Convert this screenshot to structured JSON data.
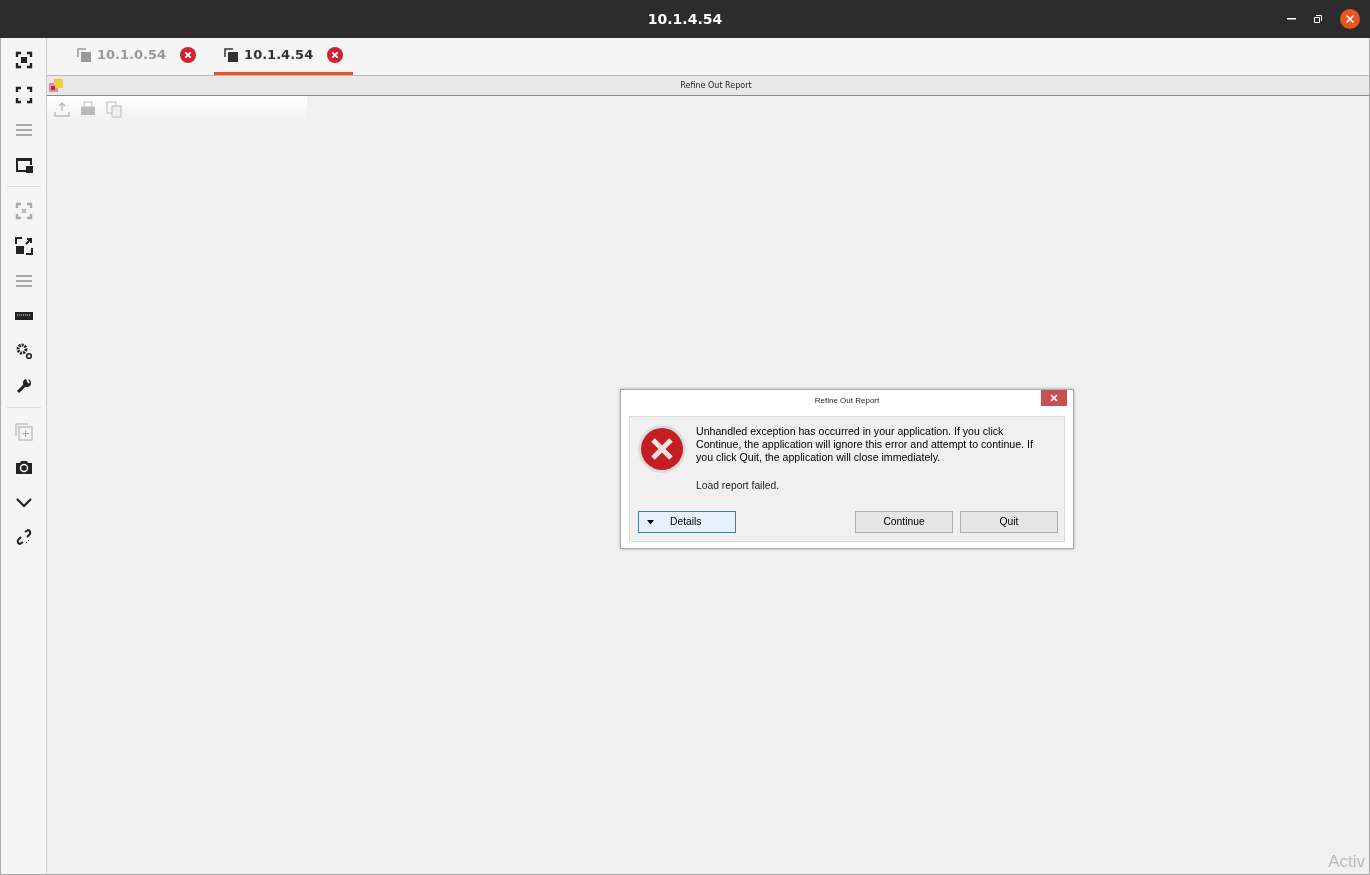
{
  "window": {
    "title": "10.1.4.54"
  },
  "sidebar": {
    "groups": [
      {
        "items": [
          {
            "disabled": false
          },
          {
            "disabled": false
          },
          {
            "disabled": true
          },
          {
            "disabled": false
          }
        ]
      },
      {
        "items": [
          {
            "disabled": true
          },
          {
            "disabled": false
          },
          {
            "disabled": true
          },
          {
            "disabled": false
          },
          {
            "disabled": false
          },
          {
            "disabled": false
          }
        ]
      },
      {
        "items": [
          {
            "disabled": true
          },
          {
            "disabled": false
          },
          {
            "disabled": false
          },
          {
            "disabled": false
          }
        ]
      }
    ]
  },
  "tabs": [
    {
      "label": "10.1.0.54",
      "selected": false
    },
    {
      "label": "10.1.4.54",
      "selected": true
    }
  ],
  "report_window": {
    "title": "Refine Out Report",
    "toolbar": [
      {
        "disabled": true
      },
      {
        "disabled": true
      },
      {
        "disabled": true
      }
    ]
  },
  "dialog": {
    "title": "Refine Out Report",
    "message": "Unhandled exception has occurred in your application. If you click Continue, the application will ignore this error and attempt to continue. If you click Quit, the application will close immediately.",
    "detail": "Load report failed.",
    "details_button": "Details",
    "buttons": [
      "Continue",
      "Quit"
    ]
  },
  "watermark_text": "Activ"
}
